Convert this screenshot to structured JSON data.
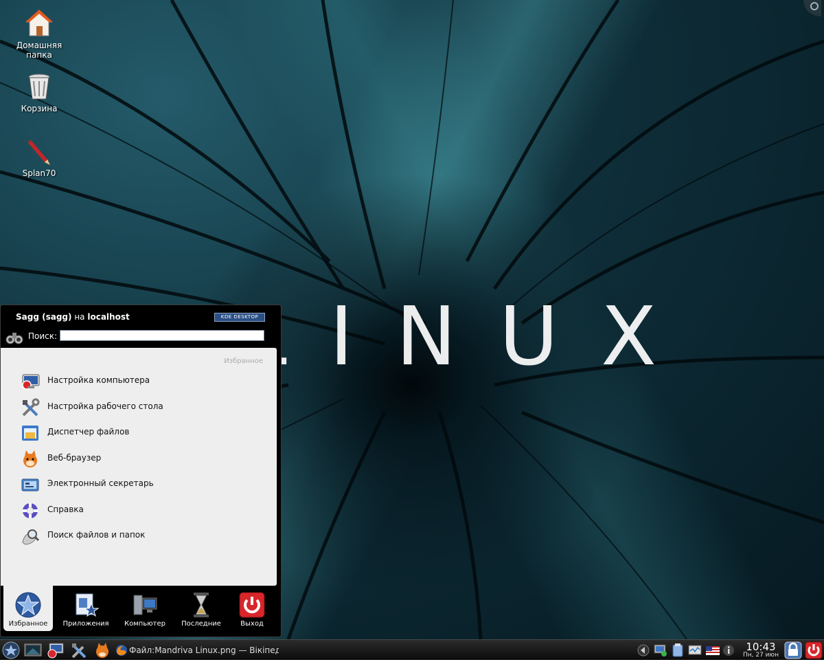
{
  "desktop": {
    "icons": [
      {
        "label": "Домашняя папка",
        "icon": "home-folder-icon"
      },
      {
        "label": "Корзина",
        "icon": "trash-icon"
      },
      {
        "label": "Splan70",
        "icon": "pencil-app-icon"
      }
    ],
    "wallpaper_text": "LINUX"
  },
  "kickoff": {
    "user": "Sagg (sagg)",
    "on": "на",
    "host": "localhost",
    "badge": "KDE DESKTOP",
    "search_label": "Поиск:",
    "search_value": "",
    "section_title": "Избранное",
    "items": [
      {
        "label": "Настройка компьютера",
        "icon": "system-settings-icon"
      },
      {
        "label": "Настройка рабочего стола",
        "icon": "desktop-settings-tools-icon"
      },
      {
        "label": "Диспетчер файлов",
        "icon": "file-manager-icon"
      },
      {
        "label": "Веб-браузер",
        "icon": "web-browser-icon"
      },
      {
        "label": "Электронный секретарь",
        "icon": "personal-organizer-icon"
      },
      {
        "label": "Справка",
        "icon": "help-lifebuoy-icon"
      },
      {
        "label": "Поиск файлов и папок",
        "icon": "find-files-icon"
      }
    ],
    "tabs": [
      {
        "label": "Избранное",
        "icon": "favorites-star-icon",
        "active": true
      },
      {
        "label": "Приложения",
        "icon": "applications-icon",
        "active": false
      },
      {
        "label": "Компьютер",
        "icon": "computer-icon",
        "active": false
      },
      {
        "label": "Последние",
        "icon": "hourglass-icon",
        "active": false
      },
      {
        "label": "Выход",
        "icon": "power-icon",
        "active": false
      }
    ]
  },
  "taskbar": {
    "launchers": [
      "kde-menu-icon",
      "show-desktop-icon",
      "system-settings-icon",
      "tools-icon",
      "browser-icon"
    ],
    "task_title": "Файл:Mandriva Linux.png — Вікіпедія",
    "tray_icons": [
      "tray-arrow-icon",
      "network-icon",
      "clipboard-icon",
      "monitor-icon",
      "keyboard-layout-flag-icon",
      "info-icon"
    ],
    "clock_time": "10:43",
    "clock_date": "Пн, 27 июн",
    "right_buttons": [
      "lock-screen-icon",
      "shutdown-icon"
    ]
  }
}
